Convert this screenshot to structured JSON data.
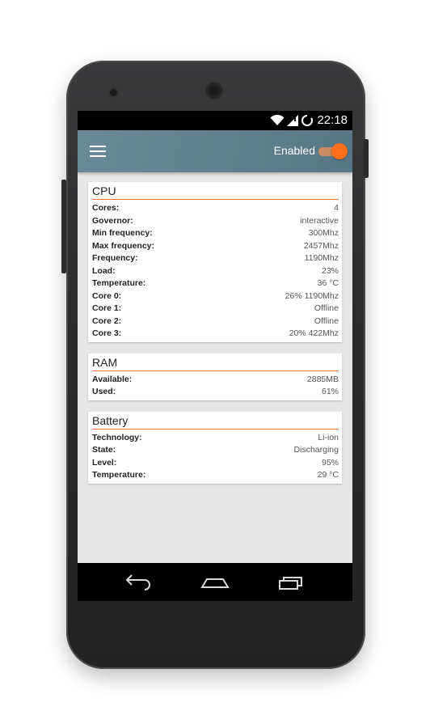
{
  "status_bar": {
    "time": "22:18",
    "icons": [
      "wifi-icon",
      "signal-icon",
      "sync-icon"
    ]
  },
  "app_bar": {
    "menu_icon": "menu-icon",
    "enabled_label": "Enabled",
    "toggle_on": true
  },
  "colors": {
    "app_bar": "#6a8a99",
    "accent": "#ff6e1a",
    "divider": "#ff6e40",
    "background": "#e6e6e6"
  },
  "cards": {
    "cpu": {
      "title": "CPU",
      "rows": [
        {
          "key": "Cores:",
          "value": "4"
        },
        {
          "key": "Governor:",
          "value": "interactive"
        },
        {
          "key": "Min frequency:",
          "value": "300Mhz"
        },
        {
          "key": "Max frequency:",
          "value": "2457Mhz"
        },
        {
          "key": "Frequency:",
          "value": "1190Mhz"
        },
        {
          "key": "Load:",
          "value": "23%"
        },
        {
          "key": "Temperature:",
          "value": "36 °C"
        },
        {
          "key": "Core 0:",
          "value": "26% 1190Mhz"
        },
        {
          "key": "Core 1:",
          "value": "Offline"
        },
        {
          "key": "Core 2:",
          "value": "Offline"
        },
        {
          "key": "Core 3:",
          "value": "20% 422Mhz"
        }
      ]
    },
    "ram": {
      "title": "RAM",
      "rows": [
        {
          "key": "Available:",
          "value": "2885MB"
        },
        {
          "key": "Used:",
          "value": "61%"
        }
      ]
    },
    "battery": {
      "title": "Battery",
      "rows": [
        {
          "key": "Technology:",
          "value": "Li-ion"
        },
        {
          "key": "State:",
          "value": "Discharging"
        },
        {
          "key": "Level:",
          "value": "95%"
        },
        {
          "key": "Temperature:",
          "value": "29 °C"
        }
      ]
    }
  },
  "nav_bar": {
    "buttons": [
      "back-icon",
      "home-icon",
      "recents-icon"
    ]
  }
}
